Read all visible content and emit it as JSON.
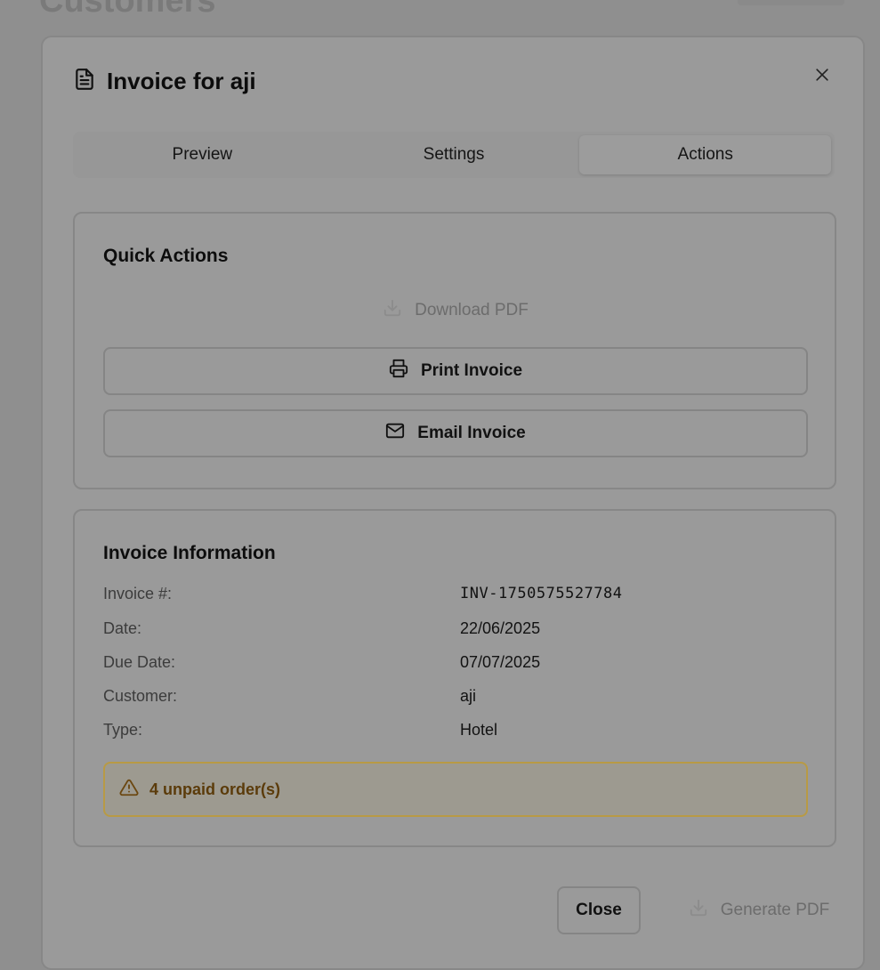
{
  "background": {
    "page_title": "Customers"
  },
  "modal": {
    "title": "Invoice for aji",
    "title_icon": "file-text-icon",
    "close_icon": "close-icon"
  },
  "tabs": [
    {
      "label": "Preview",
      "active": false
    },
    {
      "label": "Settings",
      "active": false
    },
    {
      "label": "Actions",
      "active": true
    }
  ],
  "quick_actions": {
    "title": "Quick Actions",
    "download_pdf": {
      "label": "Download PDF",
      "icon": "download-icon",
      "disabled": true
    },
    "print_invoice": {
      "label": "Print Invoice",
      "icon": "printer-icon"
    },
    "email_invoice": {
      "label": "Email Invoice",
      "icon": "mail-icon"
    }
  },
  "invoice_info": {
    "title": "Invoice Information",
    "rows": [
      {
        "label": "Invoice #:",
        "value": "INV-1750575527784"
      },
      {
        "label": "Date:",
        "value": "22/06/2025"
      },
      {
        "label": "Due Date:",
        "value": "07/07/2025"
      },
      {
        "label": "Customer:",
        "value": "aji"
      },
      {
        "label": "Type:",
        "value": "Hotel"
      }
    ],
    "alert": {
      "text": "4 unpaid order(s)",
      "icon": "warning-icon",
      "color": "#b89a45"
    }
  },
  "footer": {
    "close_label": "Close",
    "generate_label": "Generate PDF",
    "generate_disabled": true
  }
}
